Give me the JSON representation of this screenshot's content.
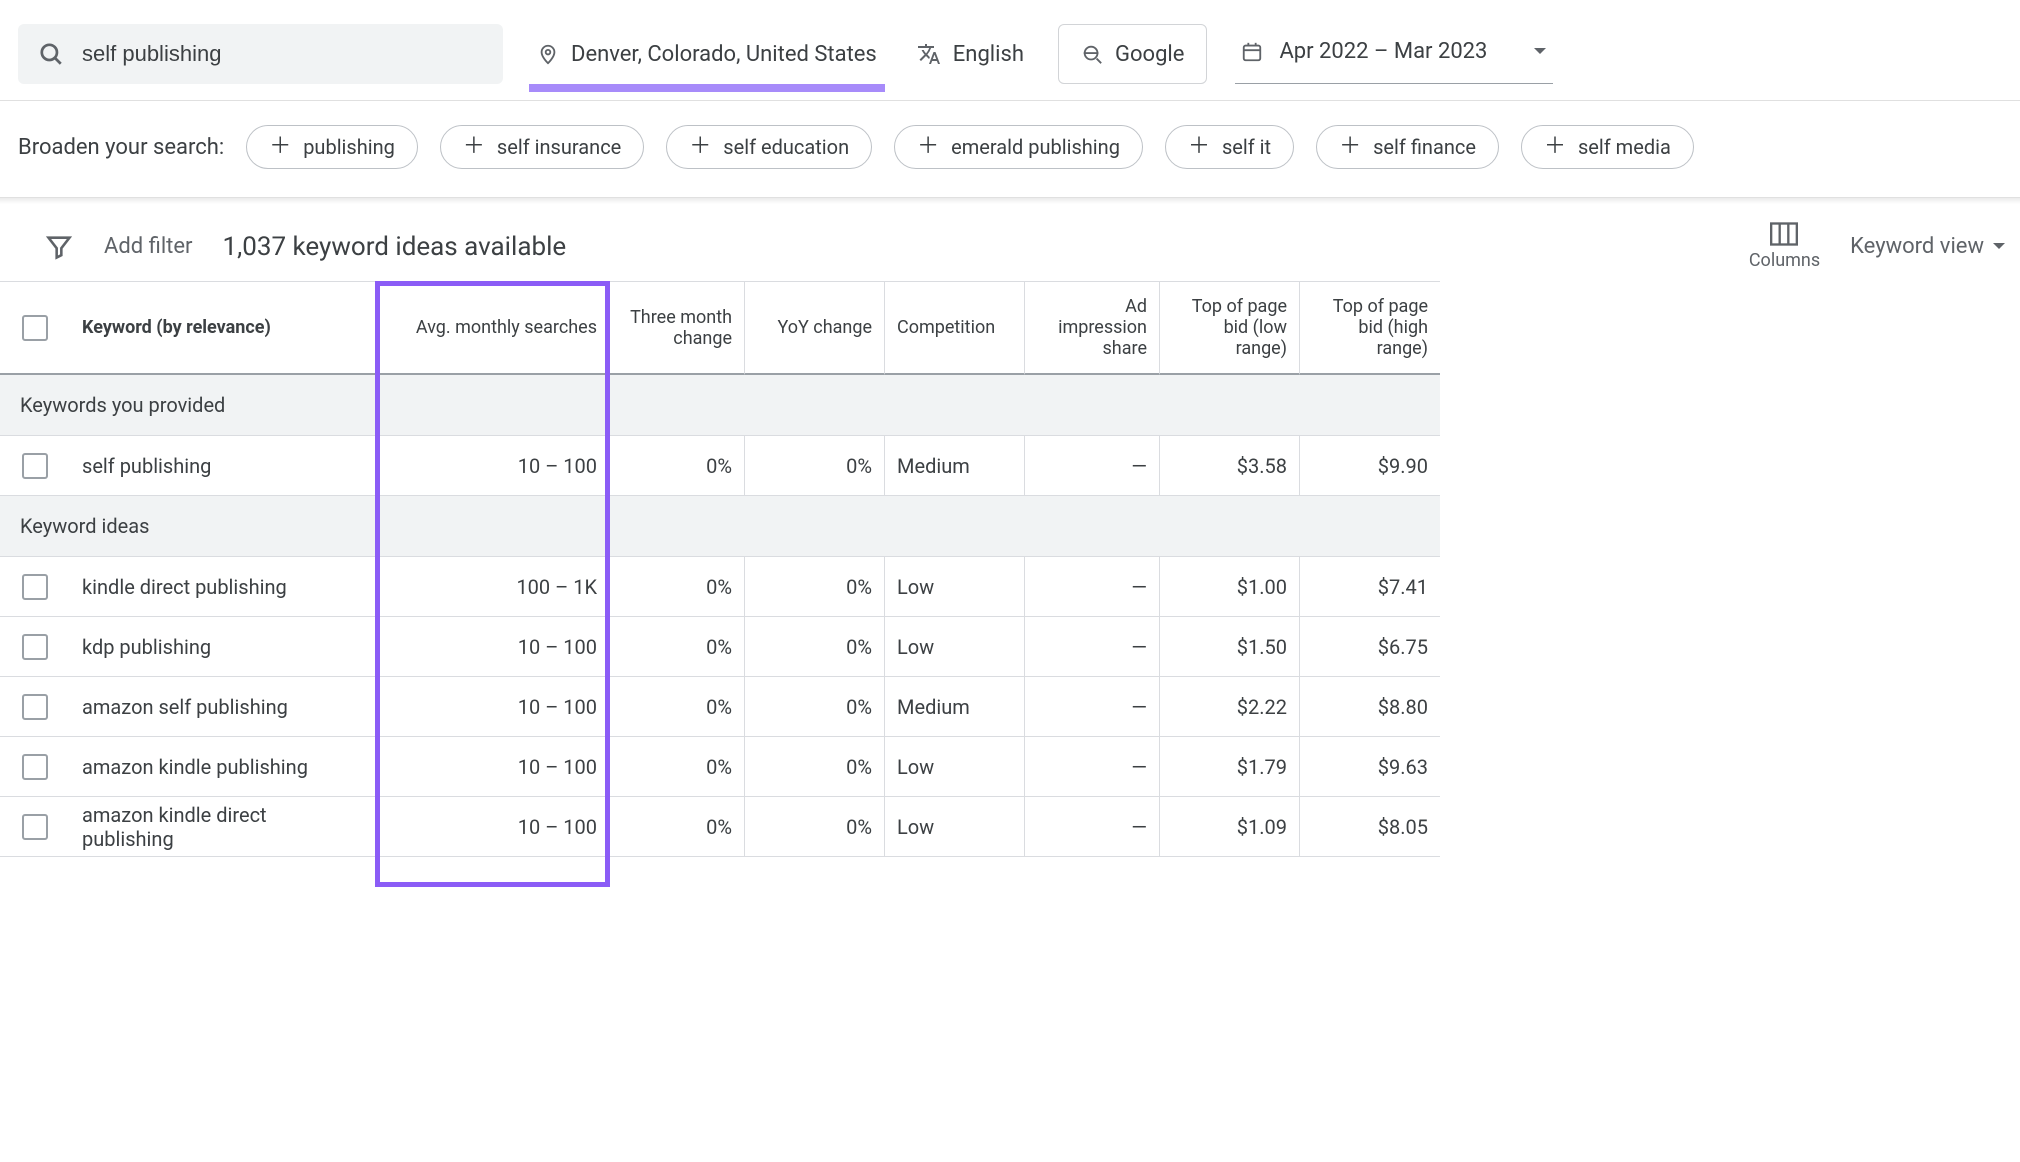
{
  "search": {
    "value": "self publishing"
  },
  "topbar": {
    "location": "Denver, Colorado, United States",
    "language": "English",
    "network": "Google",
    "date_range": "Apr 2022 – Mar 2023"
  },
  "broaden": {
    "label": "Broaden your search:",
    "chips": [
      "publishing",
      "self insurance",
      "self education",
      "emerald publishing",
      "self it",
      "self finance",
      "self media"
    ]
  },
  "filterbar": {
    "add_filter": "Add filter",
    "ideas_available": "1,037 keyword ideas available",
    "columns_label": "Columns",
    "view_label": "Keyword view"
  },
  "columns": {
    "keyword": "Keyword (by relevance)",
    "avg": "Avg. monthly searches",
    "three_month": "Three month change",
    "yoy": "YoY change",
    "competition": "Competition",
    "ad_share": "Ad impression share",
    "bid_low": "Top of page bid (low range)",
    "bid_high": "Top of page bid (high range)"
  },
  "sections": {
    "provided": "Keywords you provided",
    "ideas": "Keyword ideas"
  },
  "rows_provided": [
    {
      "keyword": "self publishing",
      "avg": "10 – 100",
      "three_month": "0%",
      "yoy": "0%",
      "competition": "Medium",
      "ad_share": "—",
      "bid_low": "$3.58",
      "bid_high": "$9.90"
    }
  ],
  "rows_ideas": [
    {
      "keyword": "kindle direct publishing",
      "avg": "100 – 1K",
      "three_month": "0%",
      "yoy": "0%",
      "competition": "Low",
      "ad_share": "—",
      "bid_low": "$1.00",
      "bid_high": "$7.41"
    },
    {
      "keyword": "kdp publishing",
      "avg": "10 – 100",
      "three_month": "0%",
      "yoy": "0%",
      "competition": "Low",
      "ad_share": "—",
      "bid_low": "$1.50",
      "bid_high": "$6.75"
    },
    {
      "keyword": "amazon self publishing",
      "avg": "10 – 100",
      "three_month": "0%",
      "yoy": "0%",
      "competition": "Medium",
      "ad_share": "—",
      "bid_low": "$2.22",
      "bid_high": "$8.80"
    },
    {
      "keyword": "amazon kindle publishing",
      "avg": "10 – 100",
      "three_month": "0%",
      "yoy": "0%",
      "competition": "Low",
      "ad_share": "—",
      "bid_low": "$1.79",
      "bid_high": "$9.63"
    },
    {
      "keyword": "amazon kindle direct publishing",
      "avg": "10 – 100",
      "three_month": "0%",
      "yoy": "0%",
      "competition": "Low",
      "ad_share": "—",
      "bid_low": "$1.09",
      "bid_high": "$8.05"
    }
  ]
}
